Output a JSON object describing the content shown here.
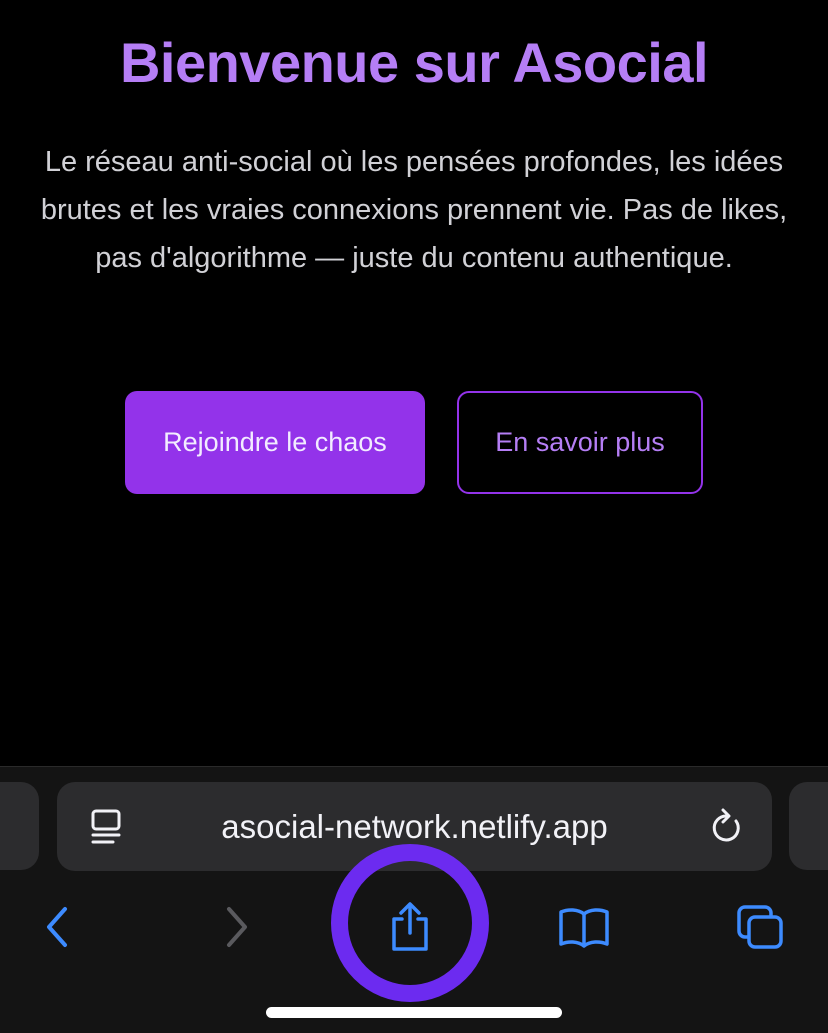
{
  "hero": {
    "title": "Bienvenue sur Asocial",
    "description": "Le réseau anti-social où les pensées profondes, les idées brutes et les vraies connexions prennent vie. Pas de likes, pas d'algorithme — juste du contenu authentique."
  },
  "buttons": {
    "primary_label": "Rejoindre le chaos",
    "secondary_label": "En savoir plus"
  },
  "browser": {
    "url": "asocial-network.netlify.app",
    "icons": {
      "reader": "reader-mode-icon",
      "reload": "reload-icon",
      "back": "back-chevron-icon",
      "forward": "forward-chevron-icon",
      "share": "share-icon",
      "bookmarks": "bookmarks-icon",
      "tabs": "tabs-icon"
    },
    "toolbar_states": {
      "back_enabled": true,
      "forward_enabled": false
    }
  },
  "colors": {
    "accent": "#b57ef5",
    "primary_button": "#9333ea",
    "browser_blue": "#3d8bff",
    "highlight_ring": "#6c2bf0",
    "disabled_icon": "#5a5a5e"
  }
}
